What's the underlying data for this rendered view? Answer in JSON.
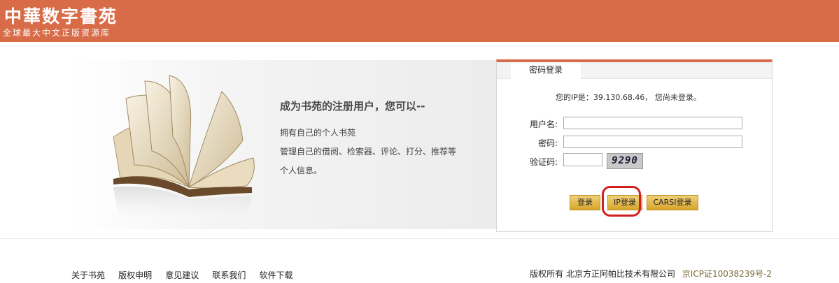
{
  "header": {
    "logo_title": "中華数字書苑",
    "logo_subtitle": "全球最大中文正版资源库",
    "bg_color": "#d86c48"
  },
  "promo": {
    "title": "成为书苑的注册用户，您可以--",
    "lines": [
      "拥有自己的个人书苑",
      "管理自己的借阅、检索器、评论、打分、推荐等",
      "个人信息。"
    ]
  },
  "login": {
    "tab_label": "密码登录",
    "ip_status": "您的IP是：39.130.68.46， 您尚未登录。",
    "username_label": "用户名:",
    "password_label": "密码:",
    "captcha_label": "验证码:",
    "username_value": "",
    "password_value": "",
    "captcha_value": "",
    "captcha_image_text": "9290",
    "buttons": {
      "login": "登录",
      "ip_login": "IP登录",
      "carsi_login": "CARSI登录"
    },
    "accent_color": "#d86c48",
    "button_color": "#e0b03a",
    "highlight_color": "#d02020"
  },
  "footer": {
    "links": [
      "关于书苑",
      "版权申明",
      "意见建议",
      "联系我们",
      "软件下载"
    ],
    "copyright": "版权所有 北京方正阿帕比技术有限公司",
    "icp": "京ICP证10038239号-2"
  }
}
